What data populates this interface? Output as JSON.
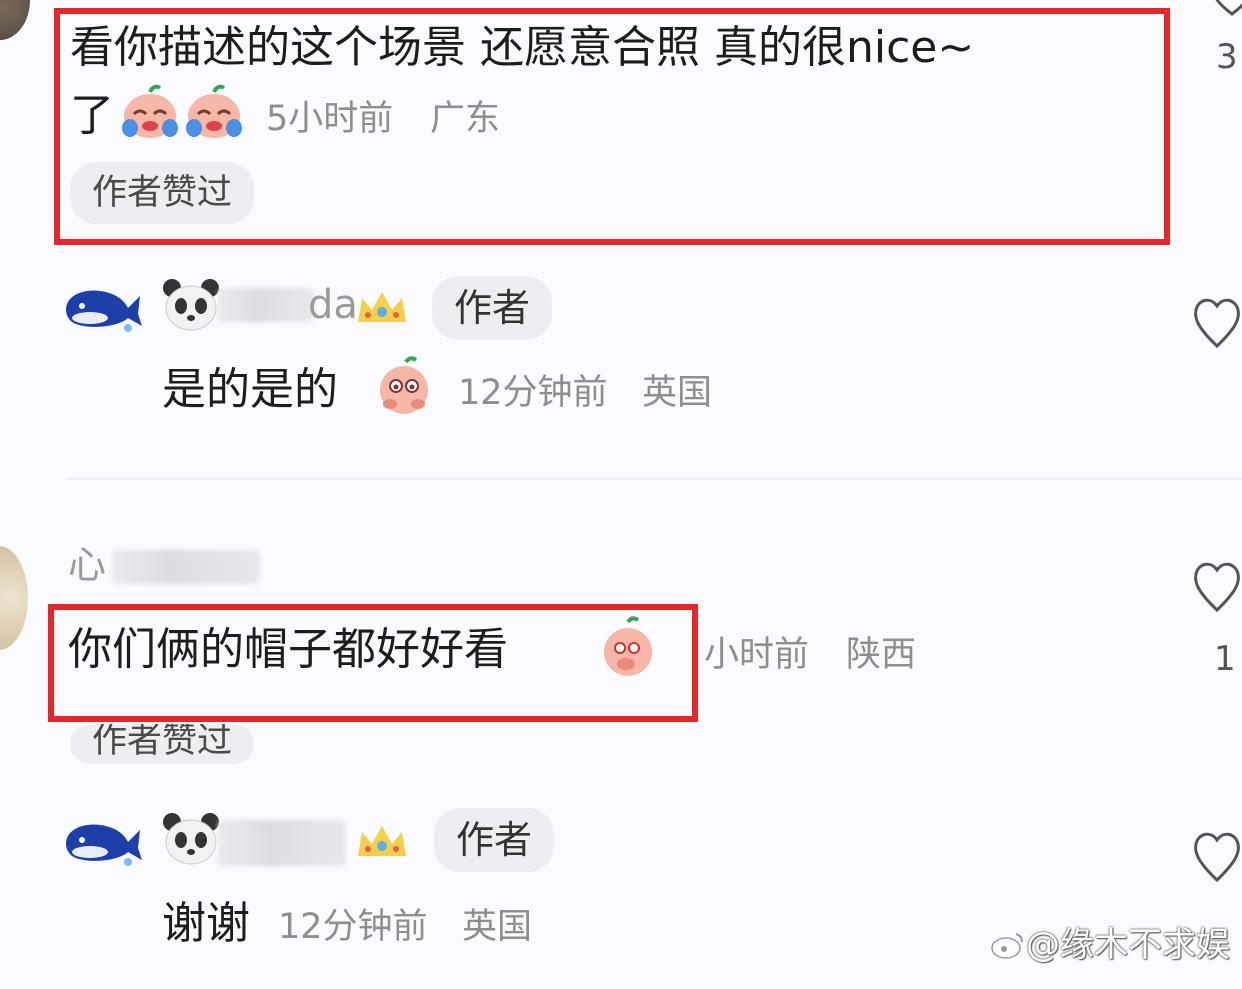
{
  "comments": [
    {
      "text_line1": "看你描述的这个场景 还愿意合照 真的很nice~",
      "text_line2": "了",
      "time": "5小时前",
      "location": "广东",
      "badge": "作者赞过",
      "like_count": "3"
    },
    {
      "author_visible": "da",
      "author_tag": "作者",
      "text": "是的是的",
      "time": "12分钟前",
      "location": "英国"
    },
    {
      "username_visible": "心",
      "text": "你们俩的帽子都好好看",
      "time": "小时前",
      "location": "陕西",
      "badge": "作者赞过",
      "like_count": "1"
    },
    {
      "author_tag": "作者",
      "text": "谢谢",
      "time": "12分钟前",
      "location": "英国"
    }
  ],
  "watermark": "@缘木不求娱",
  "colors": {
    "highlight_box": "#e5262a",
    "meta_text": "#8e8e8e",
    "pill_bg": "#eceef1"
  },
  "icons": [
    "heart-icon",
    "whale-avatar-icon",
    "panda-icon",
    "crown-icon",
    "crying-emoji-icon",
    "shy-emoji-icon",
    "weibo-logo-icon"
  ]
}
